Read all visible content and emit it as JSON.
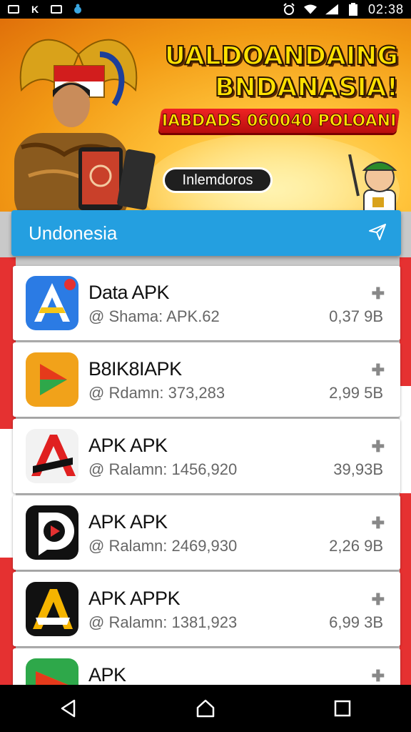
{
  "status_bar": {
    "time": "02:38",
    "left_icons": [
      "image-icon",
      "k-icon",
      "gallery-icon",
      "bug-icon"
    ],
    "right_icons": [
      "alarm-icon",
      "wifi-icon",
      "signal-icon",
      "battery-icon"
    ],
    "k_label": "K"
  },
  "banner": {
    "headline_line1": "UALDOANDAING",
    "headline_line2": "BNDANASIA!",
    "subheadline": "IABDADS 060040 POLOANI",
    "button_label": "Inlemdoros"
  },
  "search": {
    "label": "Undonesia"
  },
  "apps": [
    {
      "name": "Data APK",
      "meta": "Shama: APK.62",
      "size": "0,37 9B",
      "icon": "apk-a-blue-icon"
    },
    {
      "name": "B8IK8IAPK",
      "meta": "Rdamn: 373,283",
      "size": "2,99 5B",
      "icon": "play-orange-icon"
    },
    {
      "name": "APK APK",
      "meta": "Ralamn: 1456,920",
      "size": "39,93B",
      "icon": "apk-a-red-icon"
    },
    {
      "name": "APK APK",
      "meta": "Ralamn: 2469,930",
      "size": "2,26 9B",
      "icon": "play-dark-icon"
    },
    {
      "name": "APK APPK",
      "meta": "Ralamn: 1381,923",
      "size": "6,99 3B",
      "icon": "apk-a-yellow-icon"
    },
    {
      "name": "APK",
      "meta": "",
      "size": "",
      "icon": "play-store-icon"
    }
  ],
  "nav": [
    "back-icon",
    "home-icon",
    "recents-icon"
  ],
  "colors": {
    "accent": "#249fe0",
    "banner_red": "#e02020",
    "headline_yellow": "#ffe100"
  }
}
